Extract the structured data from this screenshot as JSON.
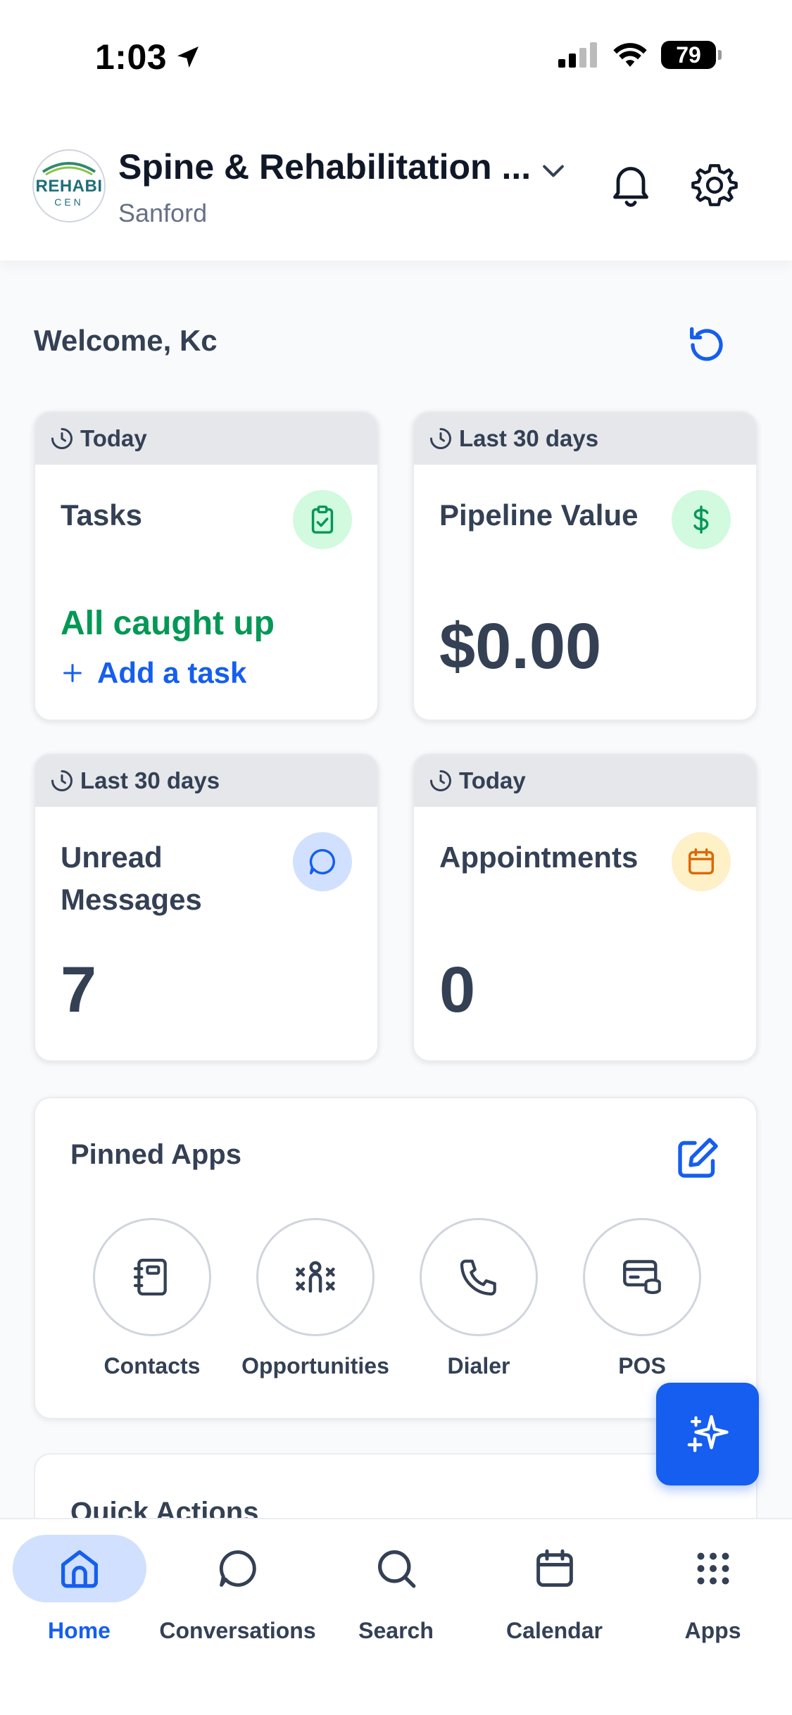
{
  "status_bar": {
    "time": "1:03",
    "battery": "79"
  },
  "header": {
    "business_name": "Spine & Rehabilitation ...",
    "location": "Sanford",
    "logo_text": "REHABI",
    "logo_sub": "CEN"
  },
  "welcome": "Welcome, Kc",
  "cards": {
    "tasks": {
      "period": "Today",
      "title": "Tasks",
      "status": "All caught up",
      "action": "Add a task"
    },
    "pipeline": {
      "period": "Last 30 days",
      "title": "Pipeline Value",
      "value": "$0.00"
    },
    "messages": {
      "period": "Last 30 days",
      "title": "Unread Messages",
      "value": "7"
    },
    "appointments": {
      "period": "Today",
      "title": "Appointments",
      "value": "0"
    }
  },
  "pinned_apps": {
    "title": "Pinned Apps",
    "items": [
      {
        "label": "Contacts",
        "icon": "contacts-book-icon"
      },
      {
        "label": "Opportunities",
        "icon": "opportunities-icon"
      },
      {
        "label": "Dialer",
        "icon": "phone-icon"
      },
      {
        "label": "POS",
        "icon": "pos-icon"
      }
    ]
  },
  "quick_actions": {
    "title": "Quick Actions"
  },
  "tabs": [
    {
      "label": "Home",
      "active": true
    },
    {
      "label": "Conversations",
      "active": false
    },
    {
      "label": "Search",
      "active": false
    },
    {
      "label": "Calendar",
      "active": false
    },
    {
      "label": "Apps",
      "active": false
    }
  ],
  "colors": {
    "primary": "#155eef",
    "success": "#039855",
    "text": "#344054",
    "card_header": "#e5e7eb"
  }
}
